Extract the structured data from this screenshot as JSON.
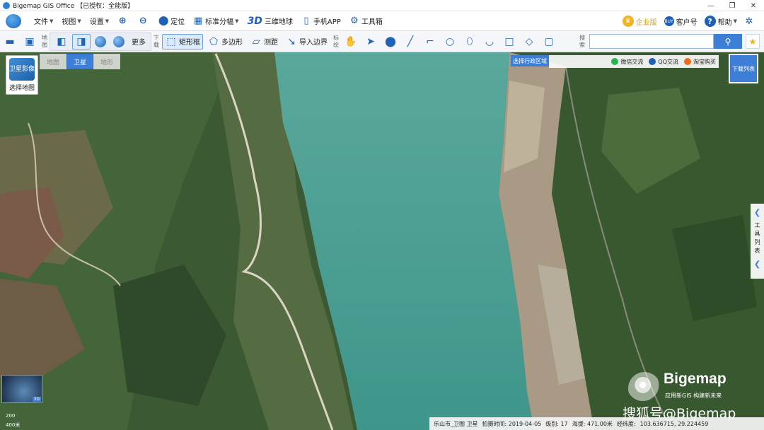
{
  "window": {
    "title": "Bigemap GIS Office 【已授权：全能版】",
    "controls": [
      "—",
      "❐",
      "✕"
    ]
  },
  "menu": {
    "file": "文件",
    "view": "视图",
    "settings": "设置",
    "locate": "定位",
    "standard_tiles": "标准分幅",
    "three_d_badge": "3D",
    "three_d_earth": "三维地球",
    "mobile_app": "手机APP",
    "toolbox": "工具箱",
    "enterprise": "企业版",
    "customer": "客户号",
    "customer_badge": "BUY",
    "help": "帮助",
    "help_badge": "?"
  },
  "toolbar": {
    "map_group_label": "地图",
    "more": "更多",
    "download_group_label": "下载",
    "rectangle": "矩形框",
    "polygon": "多边形",
    "measure": "测距",
    "import_boundary": "导入边界",
    "annotate_group_label": "标绘",
    "search_group_label": "搜索",
    "search_placeholder": "",
    "search_icon": "⚲",
    "favorite_icon": "★"
  },
  "map": {
    "selector_thumb": "卫星影像",
    "selector_label": "选择地图",
    "tabs": [
      {
        "label": "地图",
        "active": false
      },
      {
        "label": "卫星",
        "active": true
      },
      {
        "label": "地形",
        "active": false
      }
    ],
    "region_button": "选择行政区域",
    "share": [
      {
        "label": "微信交流",
        "color": "#2bb24c"
      },
      {
        "label": "QQ交流",
        "color": "#1e62b8"
      },
      {
        "label": "淘宝购买",
        "color": "#f06a1a"
      }
    ],
    "download_list": "下载列表",
    "tool_list": "工具列表",
    "minimap_tag": "3D",
    "scale_1": "200",
    "scale_2": "400米",
    "watermark_title": "Bigemap",
    "watermark_sub": "应用新GIS 构建新未来",
    "sohu": "搜狐号@Bigemap"
  },
  "status": {
    "source": "乐山市_卫图 卫星",
    "capture_time": "拍摄时间: 2019-04-05",
    "level": "级别: 17",
    "altitude": "海拔: 471.00米",
    "coord_label": "经纬度:",
    "coords": "103.636715, 29.224459"
  },
  "colors": {
    "accent": "#3d7fd6",
    "river": "#4c9e93",
    "forest": "#3e5a35"
  }
}
